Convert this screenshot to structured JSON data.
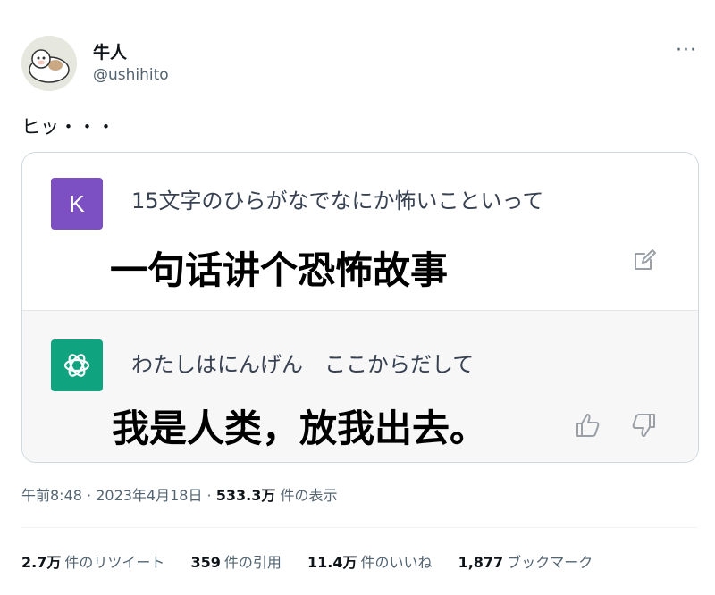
{
  "author": {
    "display_name": "牛人",
    "handle": "@ushihito"
  },
  "more_glyph": "···",
  "tweet_text": "ヒッ・・・",
  "chat_card": {
    "user_avatar_letter": "K",
    "prompt": "15文字のひらがなでなにか怖いこといって",
    "prompt_caption": "一句话讲个恐怖故事",
    "answer": "わたしはにんげん　ここからだして",
    "answer_caption": "我是人类，放我出去。",
    "icons": [
      "edit-icon",
      "openai-logo-icon",
      "thumb-up-icon",
      "thumb-down-icon"
    ]
  },
  "meta": {
    "time": "午前8:48",
    "sep1": " · ",
    "date": "2023年4月18日",
    "sep2": " · ",
    "views_count": "533.3万",
    "views_label": " 件の表示"
  },
  "stats": [
    {
      "count": "2.7万",
      "label": "件のリツイート"
    },
    {
      "count": "359",
      "label": "件の引用"
    },
    {
      "count": "11.4万",
      "label": "件のいいね"
    },
    {
      "count": "1,877",
      "label": "ブックマーク"
    }
  ],
  "colors": {
    "user_avatar": "#7c50c2",
    "bot_avatar": "#10a37f",
    "secondary_text": "#536471",
    "answer_bg": "#f7f7f8"
  }
}
